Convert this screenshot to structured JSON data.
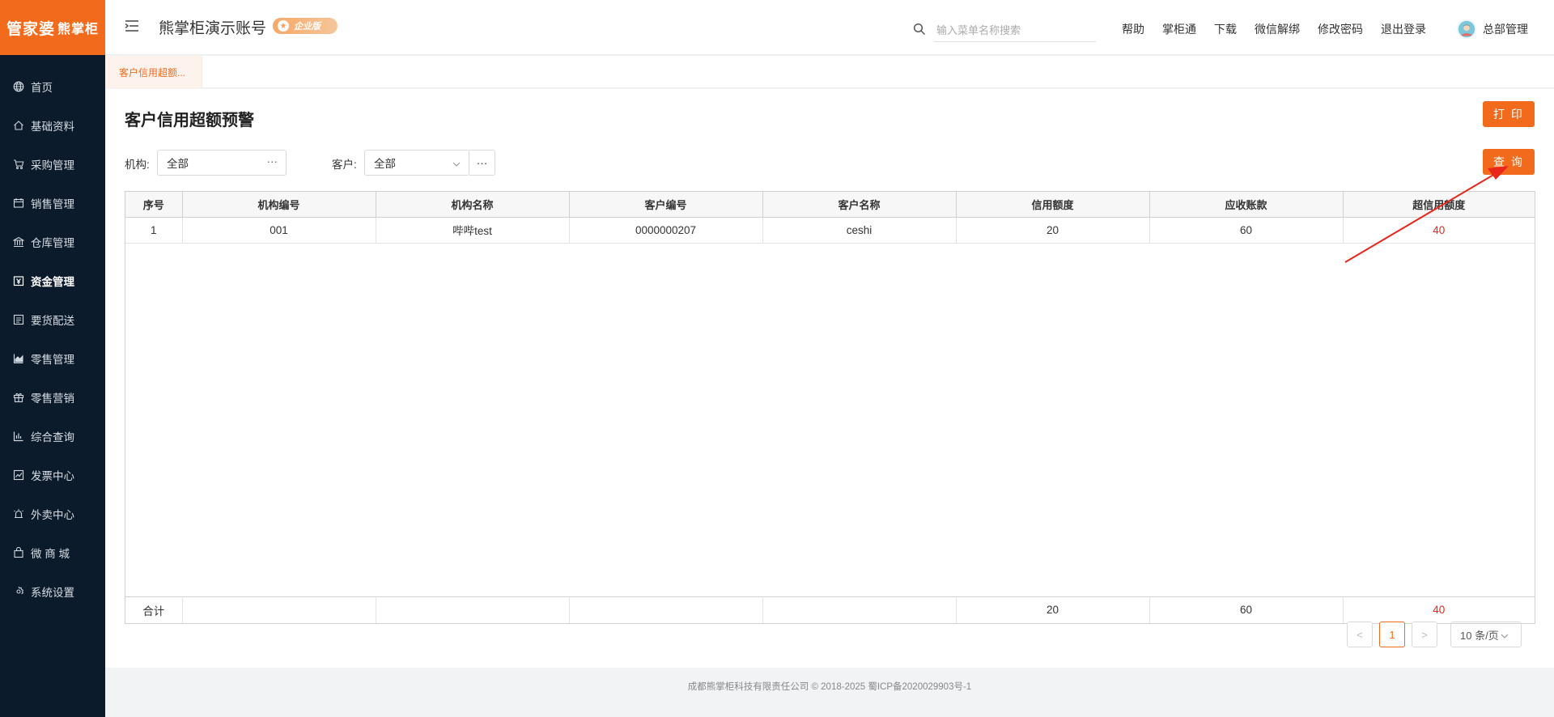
{
  "logo": {
    "part1": "管家婆",
    "part2": "熊掌柜"
  },
  "sidebar": {
    "items": [
      {
        "label": "首页",
        "icon": "globe-icon"
      },
      {
        "label": "基础资料",
        "icon": "home-icon"
      },
      {
        "label": "采购管理",
        "icon": "cart-icon"
      },
      {
        "label": "销售管理",
        "icon": "calendar-icon"
      },
      {
        "label": "仓库管理",
        "icon": "bank-icon"
      },
      {
        "label": "资金管理",
        "icon": "money-icon",
        "active": true
      },
      {
        "label": "要货配送",
        "icon": "list-icon"
      },
      {
        "label": "零售管理",
        "icon": "area-chart-icon"
      },
      {
        "label": "零售营销",
        "icon": "gift-icon"
      },
      {
        "label": "综合查询",
        "icon": "bar-chart-icon"
      },
      {
        "label": "发票中心",
        "icon": "trend-icon"
      },
      {
        "label": "外卖中心",
        "icon": "alarm-icon"
      },
      {
        "label": "微 商 城",
        "icon": "bag-icon"
      },
      {
        "label": "系统设置",
        "icon": "gear-icon"
      }
    ]
  },
  "header": {
    "account_title": "熊掌柜演示账号",
    "edition_badge": "企业版",
    "search_placeholder": "输入菜单名称搜索",
    "links": [
      "帮助",
      "掌柜通",
      "下载",
      "微信解绑",
      "修改密码",
      "退出登录"
    ],
    "user_name": "总部管理"
  },
  "tabs": [
    {
      "label": "客户信用超额..."
    }
  ],
  "page": {
    "title": "客户信用超额预警",
    "print_label": "打 印",
    "query_label": "查 询",
    "filters": {
      "org_label": "机构:",
      "org_value": "全部",
      "org_more": "···",
      "customer_label": "客户:",
      "customer_value": "全部",
      "customer_more": "···"
    }
  },
  "table": {
    "columns": [
      "序号",
      "机构编号",
      "机构名称",
      "客户编号",
      "客户名称",
      "信用额度",
      "应收账款",
      "超信用额度"
    ],
    "rows": [
      [
        "1",
        "001",
        "哔哔test",
        "0000000207",
        "ceshi",
        "20",
        "60",
        "40"
      ]
    ],
    "total": [
      "合计",
      "",
      "",
      "",
      "",
      "20",
      "60",
      "40"
    ]
  },
  "pagination": {
    "prev": "<",
    "current": "1",
    "next": ">",
    "page_size": "10 条/页"
  },
  "footer": {
    "text": "成都熊掌柜科技有限责任公司 © 2018-2025 蜀ICP备2020029903号-1"
  },
  "colors": {
    "brand": "#f26a1b",
    "sidebar_bg": "#0c1b2b",
    "excess_red": "#e8261a",
    "annotation": "#e8261a"
  }
}
